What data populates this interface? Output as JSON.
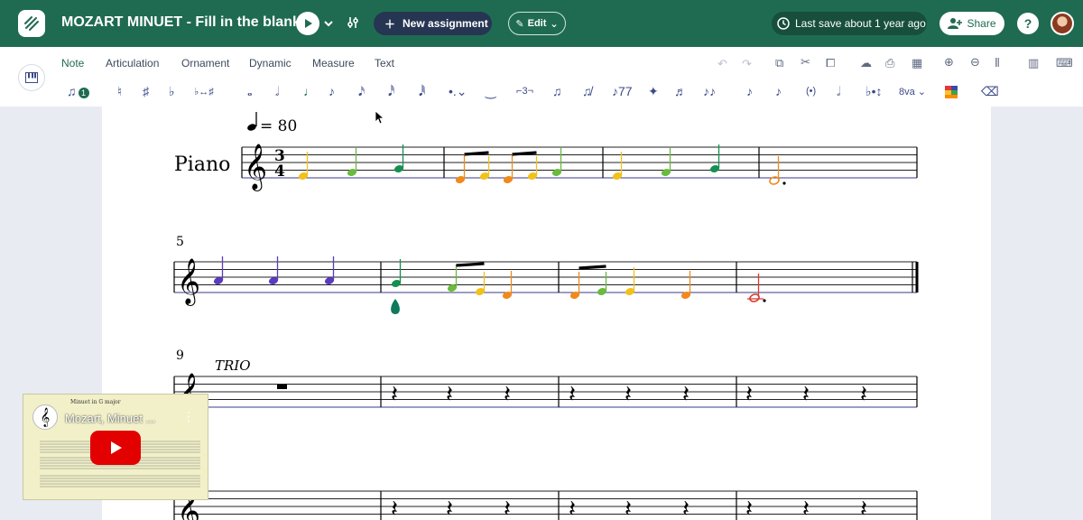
{
  "header": {
    "title": "MOZART MINUET - Fill in the blank!",
    "new_assignment_label": "New assignment",
    "edit_label": "Edit",
    "last_save": "Last save about 1 year ago",
    "share_label": "Share",
    "help_label": "?"
  },
  "toolbar": {
    "tabs": [
      "Note",
      "Articulation",
      "Ornament",
      "Dynamic",
      "Measure",
      "Text"
    ],
    "active_tab": "Note",
    "voice_number": "1",
    "triplet_label": "3",
    "octave_label": "8va"
  },
  "score": {
    "tempo": "= 80",
    "instrument": "Piano",
    "time_signature_top": "3",
    "time_signature_bottom": "4",
    "measure_numbers": [
      "5",
      "9"
    ],
    "section_label": "TRIO"
  },
  "video": {
    "title": "Mozart, Minuet ...",
    "subtitle": "Minuet in G major"
  },
  "colors": {
    "header_bg": "#1f6b52",
    "accent": "#1f6b52",
    "note_yellow": "#f2c11a",
    "note_lime": "#6aba3e",
    "note_green": "#159050",
    "note_orange": "#f08a1d",
    "note_purple": "#5a3bbf",
    "note_red": "#d83b2b",
    "teal_drop": "#0f7a5d",
    "staff_line": "#3a3a8a"
  }
}
